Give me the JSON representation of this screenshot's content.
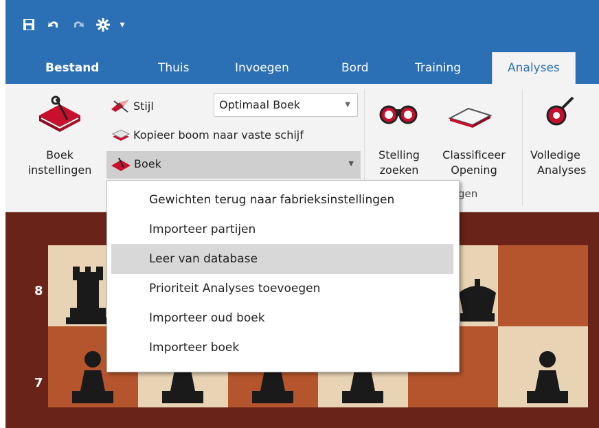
{
  "quick_access": {
    "icons": [
      "save-icon",
      "undo-icon",
      "redo-icon",
      "engine-icon",
      "customize-arrow-icon"
    ]
  },
  "tabs": [
    {
      "label": "Bestand",
      "active": false
    },
    {
      "label": "Thuis",
      "active": false
    },
    {
      "label": "Invoegen",
      "active": false
    },
    {
      "label": "Bord",
      "active": false
    },
    {
      "label": "Training",
      "active": false
    },
    {
      "label": "Analyses",
      "active": true
    }
  ],
  "ribbon": {
    "boek_instellingen": {
      "line1": "Boek",
      "line2": "instellingen"
    },
    "stijl_label": "Stijl",
    "book_select_value": "Optimaal Boek",
    "kopieer_label": "Kopieer boom naar vaste schijf",
    "boek_label": "Boek",
    "stelling": {
      "line1": "Stelling",
      "line2": "zoeken"
    },
    "classificeer": {
      "line1": "Classificeer",
      "line2": "Opening"
    },
    "volledige": {
      "line1": "Volledige",
      "line2": "Analyses"
    },
    "group_tail": "gen"
  },
  "menu": {
    "items": [
      {
        "label": "Gewichten terug naar fabrieksinstellingen",
        "highlighted": false
      },
      {
        "label": "Importeer partijen",
        "highlighted": false
      },
      {
        "label": "Leer van database",
        "highlighted": true
      },
      {
        "label": "Prioriteit Analyses toevoegen",
        "highlighted": false
      },
      {
        "label": "Importeer oud boek",
        "highlighted": false
      },
      {
        "label": "Importeer boek",
        "highlighted": false
      }
    ]
  },
  "board": {
    "ranks": [
      "8",
      "7"
    ]
  },
  "colors": {
    "accent": "#2b6fb4",
    "ribbon_bg": "#f3f3f3",
    "board_border": "#6a2318",
    "light_square": "#e8d3b4",
    "dark_square": "#b4552d",
    "menu_highlight": "#d8d8d8"
  }
}
